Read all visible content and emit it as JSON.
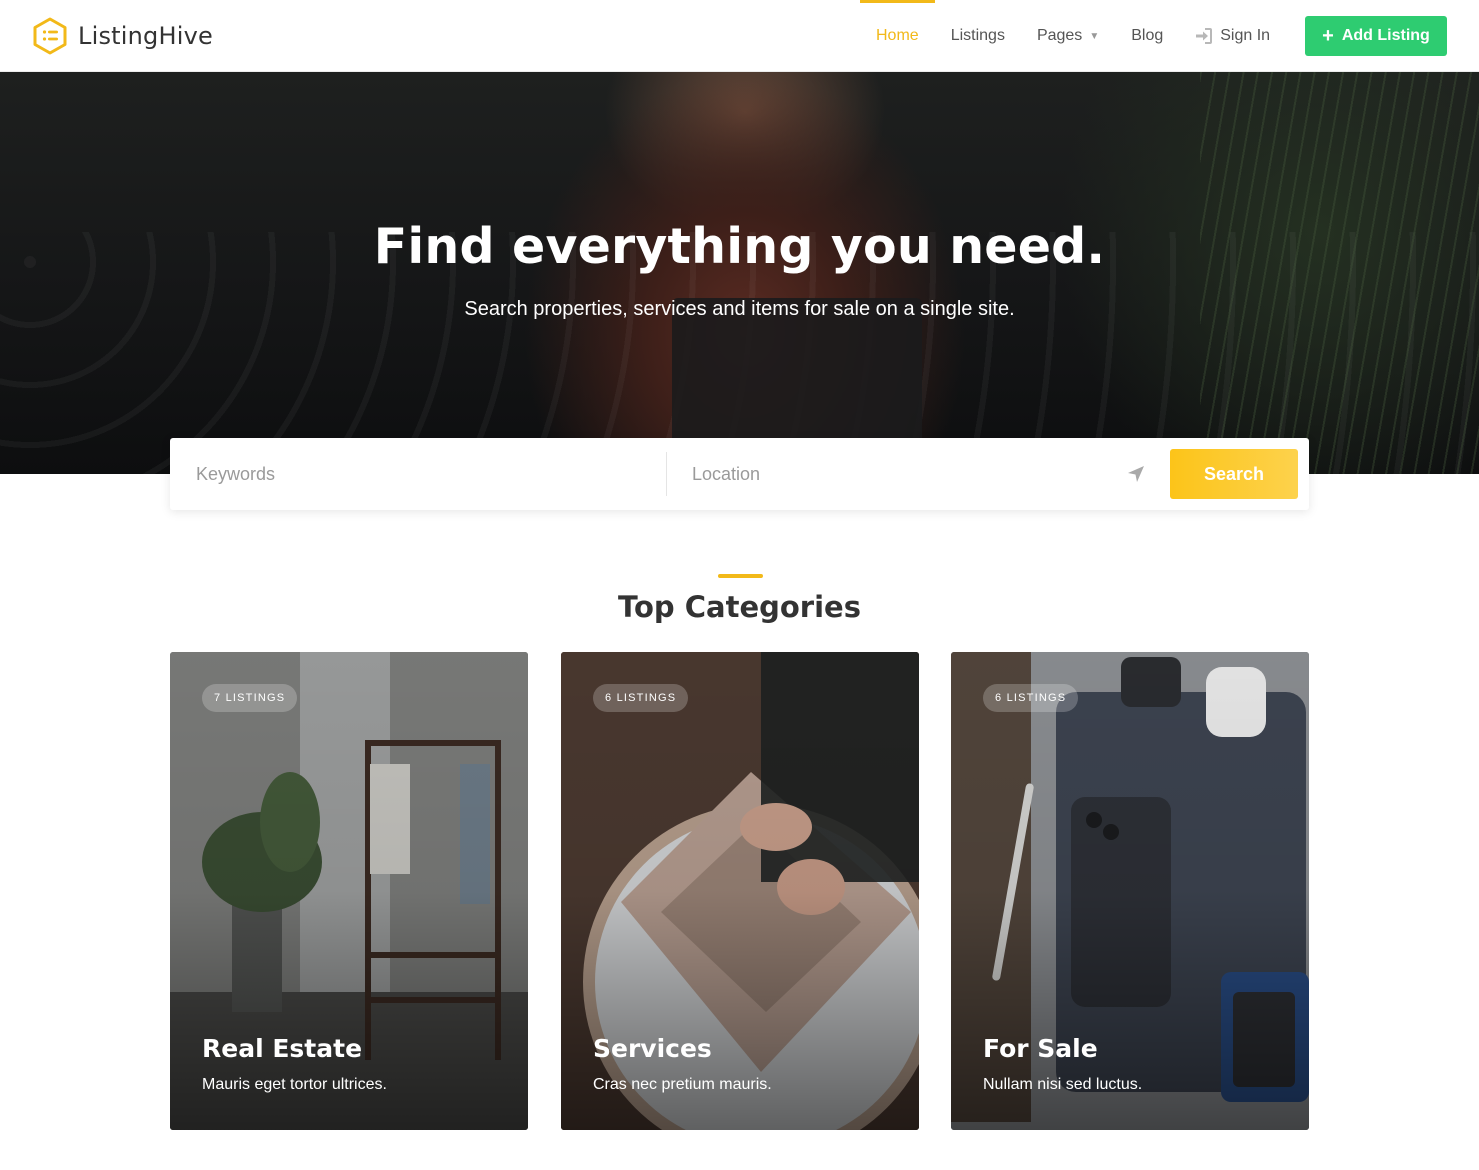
{
  "brand": {
    "name": "ListingHive",
    "logo_color": "#f2b919"
  },
  "nav": {
    "items": [
      {
        "label": "Home",
        "active": true
      },
      {
        "label": "Listings",
        "active": false
      },
      {
        "label": "Pages",
        "active": false,
        "has_dropdown": true
      },
      {
        "label": "Blog",
        "active": false
      }
    ],
    "sign_in": "Sign In",
    "add_listing": "Add Listing",
    "add_listing_color": "#2ecc71"
  },
  "hero": {
    "title": "Find everything you need.",
    "subtitle": "Search properties, services and items for sale on a single site."
  },
  "search": {
    "keywords_placeholder": "Keywords",
    "location_placeholder": "Location",
    "button": "Search",
    "button_color": "#fcc419"
  },
  "categories": {
    "title": "Top Categories",
    "accent_color": "#f2b919",
    "items": [
      {
        "badge": "7 LISTINGS",
        "title": "Real Estate",
        "description": "Mauris eget tortor ultrices."
      },
      {
        "badge": "6 LISTINGS",
        "title": "Services",
        "description": "Cras nec pretium mauris."
      },
      {
        "badge": "6 LISTINGS",
        "title": "For Sale",
        "description": "Nullam nisi sed luctus."
      }
    ]
  },
  "icons": {
    "logo": "hexagon-list-icon",
    "dropdown": "chevron-down-icon",
    "sign_in": "sign-in-icon",
    "add": "plus-icon",
    "location": "location-arrow-icon"
  }
}
